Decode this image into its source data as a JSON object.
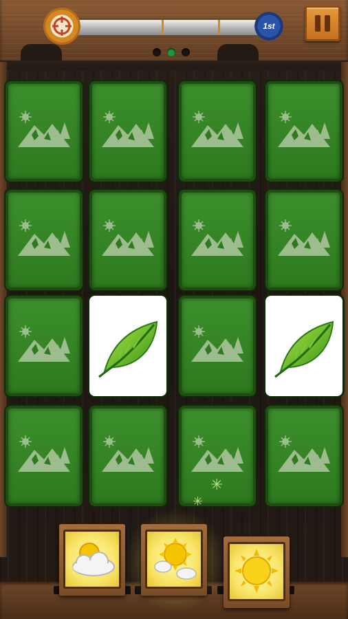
{
  "hud": {
    "rank_badge": "1st",
    "progress_fraction": 0.0,
    "page_dots": {
      "count": 3,
      "active_index": 1
    }
  },
  "grid": {
    "rows": 4,
    "cols": 4,
    "cards": [
      "back",
      "back",
      "back",
      "back",
      "back",
      "back",
      "back",
      "back",
      "back",
      "leaf",
      "back",
      "leaf",
      "back",
      "back",
      "back",
      "back"
    ],
    "back_icon": "mountain-landscape-icon",
    "face_icon": "green-leaf-icon"
  },
  "powerups": [
    {
      "icon": "sun-behind-clouds-icon"
    },
    {
      "icon": "sun-with-small-clouds-icon"
    },
    {
      "icon": "sun-icon"
    }
  ],
  "colors": {
    "card_back": "#2e7a1f",
    "card_face": "#ffffff",
    "leaf": "#4fb31c",
    "pause_button": "#d8852a",
    "rank_badge": "#2b54a8",
    "active_dot": "#1e9a3a"
  }
}
